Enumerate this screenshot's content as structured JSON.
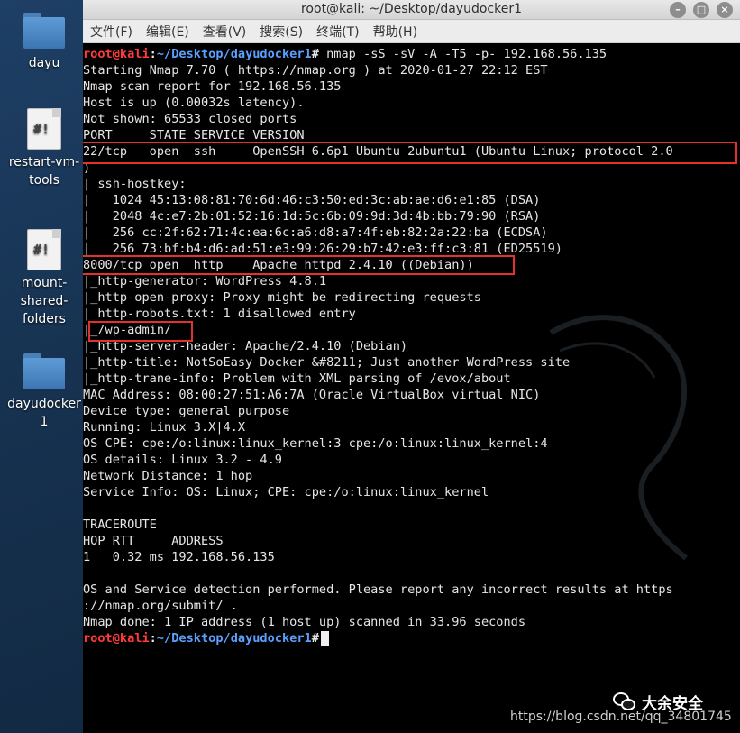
{
  "desktop": {
    "icons": [
      {
        "label": "dayu",
        "icon": "folder-icon"
      },
      {
        "label": "restart-vm-\ntools",
        "icon": "script-icon"
      },
      {
        "label": "mount-\nshared-\nfolders",
        "icon": "script-icon"
      },
      {
        "label": "dayudocker\n1",
        "icon": "folder-icon"
      }
    ]
  },
  "window": {
    "title": "root@kali: ~/Desktop/dayudocker1",
    "buttons": {
      "minimize": "–",
      "maximize": "□",
      "close": "×"
    },
    "menu": [
      "文件(F)",
      "编辑(E)",
      "查看(V)",
      "搜索(S)",
      "终端(T)",
      "帮助(H)"
    ]
  },
  "prompt": {
    "user": "root@kali",
    "sep": ":",
    "path": "~/Desktop/dayudocker1",
    "symbol": "#"
  },
  "terminal": {
    "command": " nmap -sS -sV -A -T5 -p- 192.168.56.135",
    "lines": [
      "Starting Nmap 7.70 ( https://nmap.org ) at 2020-01-27 22:12 EST",
      "Nmap scan report for 192.168.56.135",
      "Host is up (0.00032s latency).",
      "Not shown: 65533 closed ports",
      "PORT     STATE SERVICE VERSION",
      "22/tcp   open  ssh     OpenSSH 6.6p1 Ubuntu 2ubuntu1 (Ubuntu Linux; protocol 2.0",
      ")",
      "| ssh-hostkey:",
      "|   1024 45:13:08:81:70:6d:46:c3:50:ed:3c:ab:ae:d6:e1:85 (DSA)",
      "|   2048 4c:e7:2b:01:52:16:1d:5c:6b:09:9d:3d:4b:bb:79:90 (RSA)",
      "|   256 cc:2f:62:71:4c:ea:6c:a6:d8:a7:4f:eb:82:2a:22:ba (ECDSA)",
      "|   256 73:bf:b4:d6:ad:51:e3:99:26:29:b7:42:e3:ff:c3:81 (ED25519)",
      "8000/tcp open  http    Apache httpd 2.4.10 ((Debian))",
      "|_http-generator: WordPress 4.8.1",
      "|_http-open-proxy: Proxy might be redirecting requests",
      "| http-robots.txt: 1 disallowed entry",
      "|_/wp-admin/",
      "|_http-server-header: Apache/2.4.10 (Debian)",
      "|_http-title: NotSoEasy Docker &#8211; Just another WordPress site",
      "|_http-trane-info: Problem with XML parsing of /evox/about",
      "MAC Address: 08:00:27:51:A6:7A (Oracle VirtualBox virtual NIC)",
      "Device type: general purpose",
      "Running: Linux 3.X|4.X",
      "OS CPE: cpe:/o:linux:linux_kernel:3 cpe:/o:linux:linux_kernel:4",
      "OS details: Linux 3.2 - 4.9",
      "Network Distance: 1 hop",
      "Service Info: OS: Linux; CPE: cpe:/o:linux:linux_kernel",
      "",
      "TRACEROUTE",
      "HOP RTT     ADDRESS",
      "1   0.32 ms 192.168.56.135",
      "",
      "OS and Service detection performed. Please report any incorrect results at https",
      "://nmap.org/submit/ .",
      "Nmap done: 1 IP address (1 host up) scanned in 33.96 seconds"
    ]
  },
  "watermark": {
    "brand": "大余安全",
    "url": "https://blog.csdn.net/qq_34801745"
  },
  "colors": {
    "prompt_user": "#ff3b3b",
    "prompt_path": "#5aa0ff",
    "highlight": "#e53030",
    "terminal_bg": "#000000"
  }
}
